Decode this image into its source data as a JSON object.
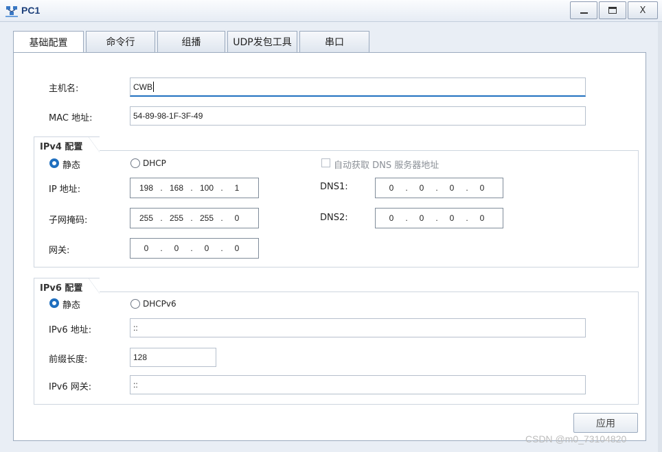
{
  "window": {
    "title": "PC1",
    "minimize_label": "",
    "maximize_label": "",
    "close_label": "X"
  },
  "tabs": [
    {
      "label": "基础配置",
      "active": true
    },
    {
      "label": "命令行",
      "active": false
    },
    {
      "label": "组播",
      "active": false
    },
    {
      "label": "UDP发包工具",
      "active": false
    },
    {
      "label": "串口",
      "active": false
    }
  ],
  "host": {
    "hostname_label": "主机名:",
    "hostname_value": "CWB",
    "mac_label": "MAC 地址:",
    "mac_value": "54-89-98-1F-3F-49"
  },
  "ipv4": {
    "group_title": "IPv4 配置",
    "static_label": "静态",
    "dhcp_label": "DHCP",
    "auto_dns_label": "自动获取 DNS 服务器地址",
    "ip_label": "IP 地址:",
    "ip": [
      "198",
      "168",
      "100",
      "1"
    ],
    "mask_label": "子网掩码:",
    "mask": [
      "255",
      "255",
      "255",
      "0"
    ],
    "gateway_label": "网关:",
    "gateway": [
      "0",
      "0",
      "0",
      "0"
    ],
    "dns1_label": "DNS1:",
    "dns1": [
      "0",
      "0",
      "0",
      "0"
    ],
    "dns2_label": "DNS2:",
    "dns2": [
      "0",
      "0",
      "0",
      "0"
    ],
    "mode": "static"
  },
  "ipv6": {
    "group_title": "IPv6 配置",
    "static_label": "静态",
    "dhcp_label": "DHCPv6",
    "ip_label": "IPv6 地址:",
    "ip_value": "::",
    "prefix_label": "前缀长度:",
    "prefix_value": "128",
    "gateway_label": "IPv6 网关:",
    "gateway_value": "::",
    "mode": "static"
  },
  "apply_label": "应用",
  "watermark": "CSDN @m0_73104820",
  "colors": {
    "accent": "#1f6fbf",
    "title_text": "#1c3f7a",
    "panel_bg": "#ffffff",
    "window_bg": "#e9eef5"
  }
}
